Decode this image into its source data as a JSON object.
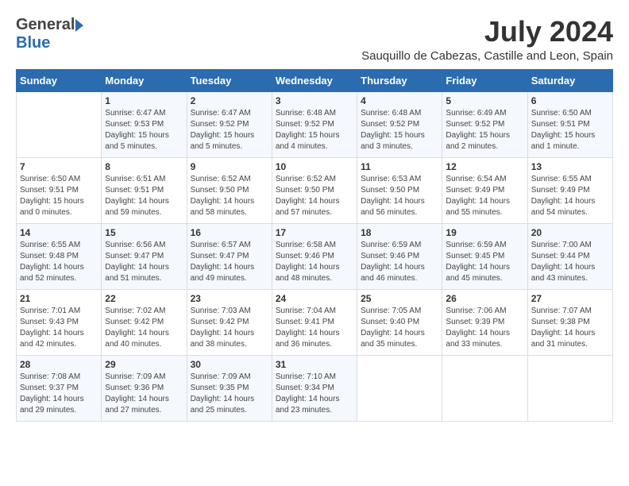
{
  "header": {
    "logo_general": "General",
    "logo_blue": "Blue",
    "month_year": "July 2024",
    "location": "Sauquillo de Cabezas, Castille and Leon, Spain"
  },
  "days_header": [
    "Sunday",
    "Monday",
    "Tuesday",
    "Wednesday",
    "Thursday",
    "Friday",
    "Saturday"
  ],
  "weeks": [
    [
      {
        "day": "",
        "lines": []
      },
      {
        "day": "1",
        "lines": [
          "Sunrise: 6:47 AM",
          "Sunset: 9:53 PM",
          "Daylight: 15 hours",
          "and 5 minutes."
        ]
      },
      {
        "day": "2",
        "lines": [
          "Sunrise: 6:47 AM",
          "Sunset: 9:52 PM",
          "Daylight: 15 hours",
          "and 5 minutes."
        ]
      },
      {
        "day": "3",
        "lines": [
          "Sunrise: 6:48 AM",
          "Sunset: 9:52 PM",
          "Daylight: 15 hours",
          "and 4 minutes."
        ]
      },
      {
        "day": "4",
        "lines": [
          "Sunrise: 6:48 AM",
          "Sunset: 9:52 PM",
          "Daylight: 15 hours",
          "and 3 minutes."
        ]
      },
      {
        "day": "5",
        "lines": [
          "Sunrise: 6:49 AM",
          "Sunset: 9:52 PM",
          "Daylight: 15 hours",
          "and 2 minutes."
        ]
      },
      {
        "day": "6",
        "lines": [
          "Sunrise: 6:50 AM",
          "Sunset: 9:51 PM",
          "Daylight: 15 hours",
          "and 1 minute."
        ]
      }
    ],
    [
      {
        "day": "7",
        "lines": [
          "Sunrise: 6:50 AM",
          "Sunset: 9:51 PM",
          "Daylight: 15 hours",
          "and 0 minutes."
        ]
      },
      {
        "day": "8",
        "lines": [
          "Sunrise: 6:51 AM",
          "Sunset: 9:51 PM",
          "Daylight: 14 hours",
          "and 59 minutes."
        ]
      },
      {
        "day": "9",
        "lines": [
          "Sunrise: 6:52 AM",
          "Sunset: 9:50 PM",
          "Daylight: 14 hours",
          "and 58 minutes."
        ]
      },
      {
        "day": "10",
        "lines": [
          "Sunrise: 6:52 AM",
          "Sunset: 9:50 PM",
          "Daylight: 14 hours",
          "and 57 minutes."
        ]
      },
      {
        "day": "11",
        "lines": [
          "Sunrise: 6:53 AM",
          "Sunset: 9:50 PM",
          "Daylight: 14 hours",
          "and 56 minutes."
        ]
      },
      {
        "day": "12",
        "lines": [
          "Sunrise: 6:54 AM",
          "Sunset: 9:49 PM",
          "Daylight: 14 hours",
          "and 55 minutes."
        ]
      },
      {
        "day": "13",
        "lines": [
          "Sunrise: 6:55 AM",
          "Sunset: 9:49 PM",
          "Daylight: 14 hours",
          "and 54 minutes."
        ]
      }
    ],
    [
      {
        "day": "14",
        "lines": [
          "Sunrise: 6:55 AM",
          "Sunset: 9:48 PM",
          "Daylight: 14 hours",
          "and 52 minutes."
        ]
      },
      {
        "day": "15",
        "lines": [
          "Sunrise: 6:56 AM",
          "Sunset: 9:47 PM",
          "Daylight: 14 hours",
          "and 51 minutes."
        ]
      },
      {
        "day": "16",
        "lines": [
          "Sunrise: 6:57 AM",
          "Sunset: 9:47 PM",
          "Daylight: 14 hours",
          "and 49 minutes."
        ]
      },
      {
        "day": "17",
        "lines": [
          "Sunrise: 6:58 AM",
          "Sunset: 9:46 PM",
          "Daylight: 14 hours",
          "and 48 minutes."
        ]
      },
      {
        "day": "18",
        "lines": [
          "Sunrise: 6:59 AM",
          "Sunset: 9:46 PM",
          "Daylight: 14 hours",
          "and 46 minutes."
        ]
      },
      {
        "day": "19",
        "lines": [
          "Sunrise: 6:59 AM",
          "Sunset: 9:45 PM",
          "Daylight: 14 hours",
          "and 45 minutes."
        ]
      },
      {
        "day": "20",
        "lines": [
          "Sunrise: 7:00 AM",
          "Sunset: 9:44 PM",
          "Daylight: 14 hours",
          "and 43 minutes."
        ]
      }
    ],
    [
      {
        "day": "21",
        "lines": [
          "Sunrise: 7:01 AM",
          "Sunset: 9:43 PM",
          "Daylight: 14 hours",
          "and 42 minutes."
        ]
      },
      {
        "day": "22",
        "lines": [
          "Sunrise: 7:02 AM",
          "Sunset: 9:42 PM",
          "Daylight: 14 hours",
          "and 40 minutes."
        ]
      },
      {
        "day": "23",
        "lines": [
          "Sunrise: 7:03 AM",
          "Sunset: 9:42 PM",
          "Daylight: 14 hours",
          "and 38 minutes."
        ]
      },
      {
        "day": "24",
        "lines": [
          "Sunrise: 7:04 AM",
          "Sunset: 9:41 PM",
          "Daylight: 14 hours",
          "and 36 minutes."
        ]
      },
      {
        "day": "25",
        "lines": [
          "Sunrise: 7:05 AM",
          "Sunset: 9:40 PM",
          "Daylight: 14 hours",
          "and 35 minutes."
        ]
      },
      {
        "day": "26",
        "lines": [
          "Sunrise: 7:06 AM",
          "Sunset: 9:39 PM",
          "Daylight: 14 hours",
          "and 33 minutes."
        ]
      },
      {
        "day": "27",
        "lines": [
          "Sunrise: 7:07 AM",
          "Sunset: 9:38 PM",
          "Daylight: 14 hours",
          "and 31 minutes."
        ]
      }
    ],
    [
      {
        "day": "28",
        "lines": [
          "Sunrise: 7:08 AM",
          "Sunset: 9:37 PM",
          "Daylight: 14 hours",
          "and 29 minutes."
        ]
      },
      {
        "day": "29",
        "lines": [
          "Sunrise: 7:09 AM",
          "Sunset: 9:36 PM",
          "Daylight: 14 hours",
          "and 27 minutes."
        ]
      },
      {
        "day": "30",
        "lines": [
          "Sunrise: 7:09 AM",
          "Sunset: 9:35 PM",
          "Daylight: 14 hours",
          "and 25 minutes."
        ]
      },
      {
        "day": "31",
        "lines": [
          "Sunrise: 7:10 AM",
          "Sunset: 9:34 PM",
          "Daylight: 14 hours",
          "and 23 minutes."
        ]
      },
      {
        "day": "",
        "lines": []
      },
      {
        "day": "",
        "lines": []
      },
      {
        "day": "",
        "lines": []
      }
    ]
  ]
}
